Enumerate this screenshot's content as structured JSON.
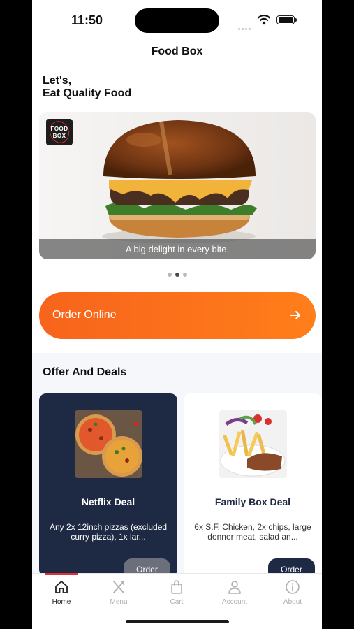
{
  "status_bar": {
    "time": "11:50"
  },
  "header": {
    "title": "Food Box"
  },
  "greeting": {
    "line1": "Let's,",
    "line2": "Eat Quality Food"
  },
  "banner": {
    "logo_line1": "FOOD",
    "logo_line2": "BOX",
    "caption": "A big delight in every bite.",
    "slides": 3,
    "active_slide": 2
  },
  "order_online": {
    "label": "Order Online"
  },
  "offers": {
    "title": "Offer And Deals",
    "deals": [
      {
        "name": "Netflix Deal",
        "description": "Any 2x 12inch pizzas (excluded curry pizza), 1x lar...",
        "button": "Order"
      },
      {
        "name": "Family Box Deal",
        "description": "6x S.F. Chicken, 2x chips, large donner meat, salad an...",
        "button": "Order"
      }
    ]
  },
  "tabbar": {
    "items": [
      {
        "label": "Home",
        "icon": "home-icon"
      },
      {
        "label": "Menu",
        "icon": "utensils-icon"
      },
      {
        "label": "Cart",
        "icon": "shopping-bag-icon"
      },
      {
        "label": "Account",
        "icon": "user-icon"
      },
      {
        "label": "About",
        "icon": "info-icon"
      }
    ],
    "active": "Home"
  },
  "colors": {
    "accent_orange": "#f7641c",
    "navy": "#1e2944",
    "tab_indicator": "#e0313a"
  }
}
